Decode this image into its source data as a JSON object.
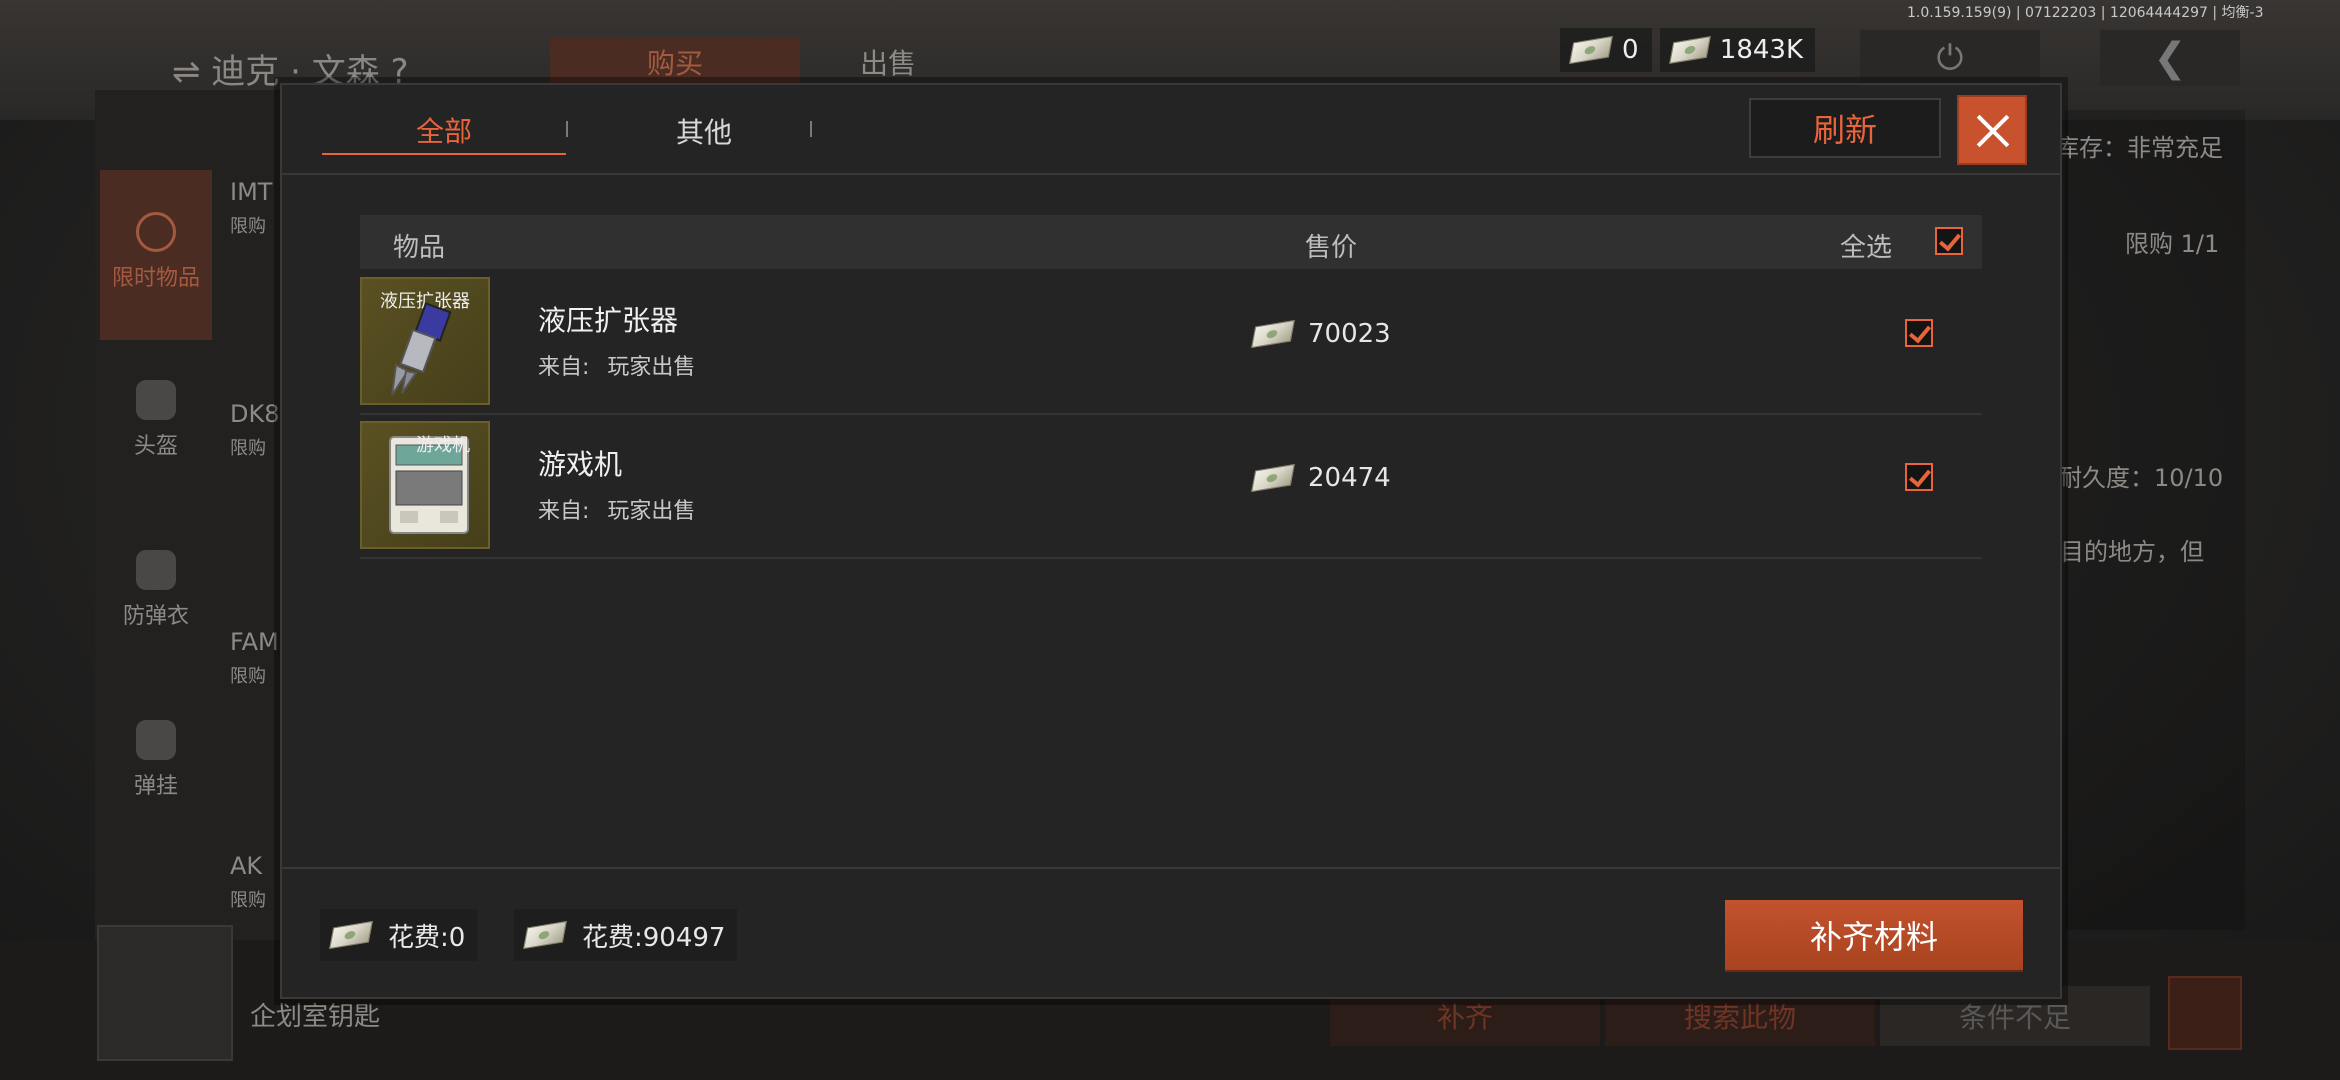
{
  "version": "1.0.159.159(9) | 07122203 | 12064444297 | 均衡-3",
  "currency": {
    "balance_a": "0",
    "balance_b": "1843K"
  },
  "background": {
    "trader_name": "迪克 · 文森",
    "help": "?",
    "tab_buy": "购买",
    "tab_sell": "出售",
    "stock": "库存：非常充足",
    "limit": "限购 1/1",
    "durability": "耐久度：10/10",
    "desc": "目的地方，但",
    "categories": [
      "限时物品",
      "头盔",
      "防弹衣",
      "弹挂"
    ],
    "items": [
      {
        "name": "IMT",
        "sub": "限购"
      },
      {
        "name": "DK8",
        "sub": "限购"
      },
      {
        "name": "FAM",
        "sub": "限购"
      },
      {
        "name": "AK",
        "sub": "限购"
      }
    ],
    "key_label": "企划室钥匙",
    "btn_restock": "补齐",
    "btn_search": "搜索此物",
    "btn_condition": "条件不足"
  },
  "modal": {
    "tabs": [
      "全部",
      "其他"
    ],
    "refresh_label": "刷新",
    "columns": {
      "item": "物品",
      "price": "售价",
      "select_all": "全选"
    },
    "rows": [
      {
        "thumb_label": "液压扩张器",
        "name": "液压扩张器",
        "source_label": "来自:",
        "source": "玩家出售",
        "price": "70023",
        "checked": true
      },
      {
        "thumb_label": "游戏机",
        "name": "游戏机",
        "source_label": "来自:",
        "source": "玩家出售",
        "price": "20474",
        "checked": true
      }
    ],
    "fees": [
      {
        "label": "花费:0"
      },
      {
        "label": "花费:90497"
      }
    ],
    "restock_label": "补齐材料"
  },
  "colors": {
    "accent": "#e8643a",
    "button": "#c3522e"
  }
}
